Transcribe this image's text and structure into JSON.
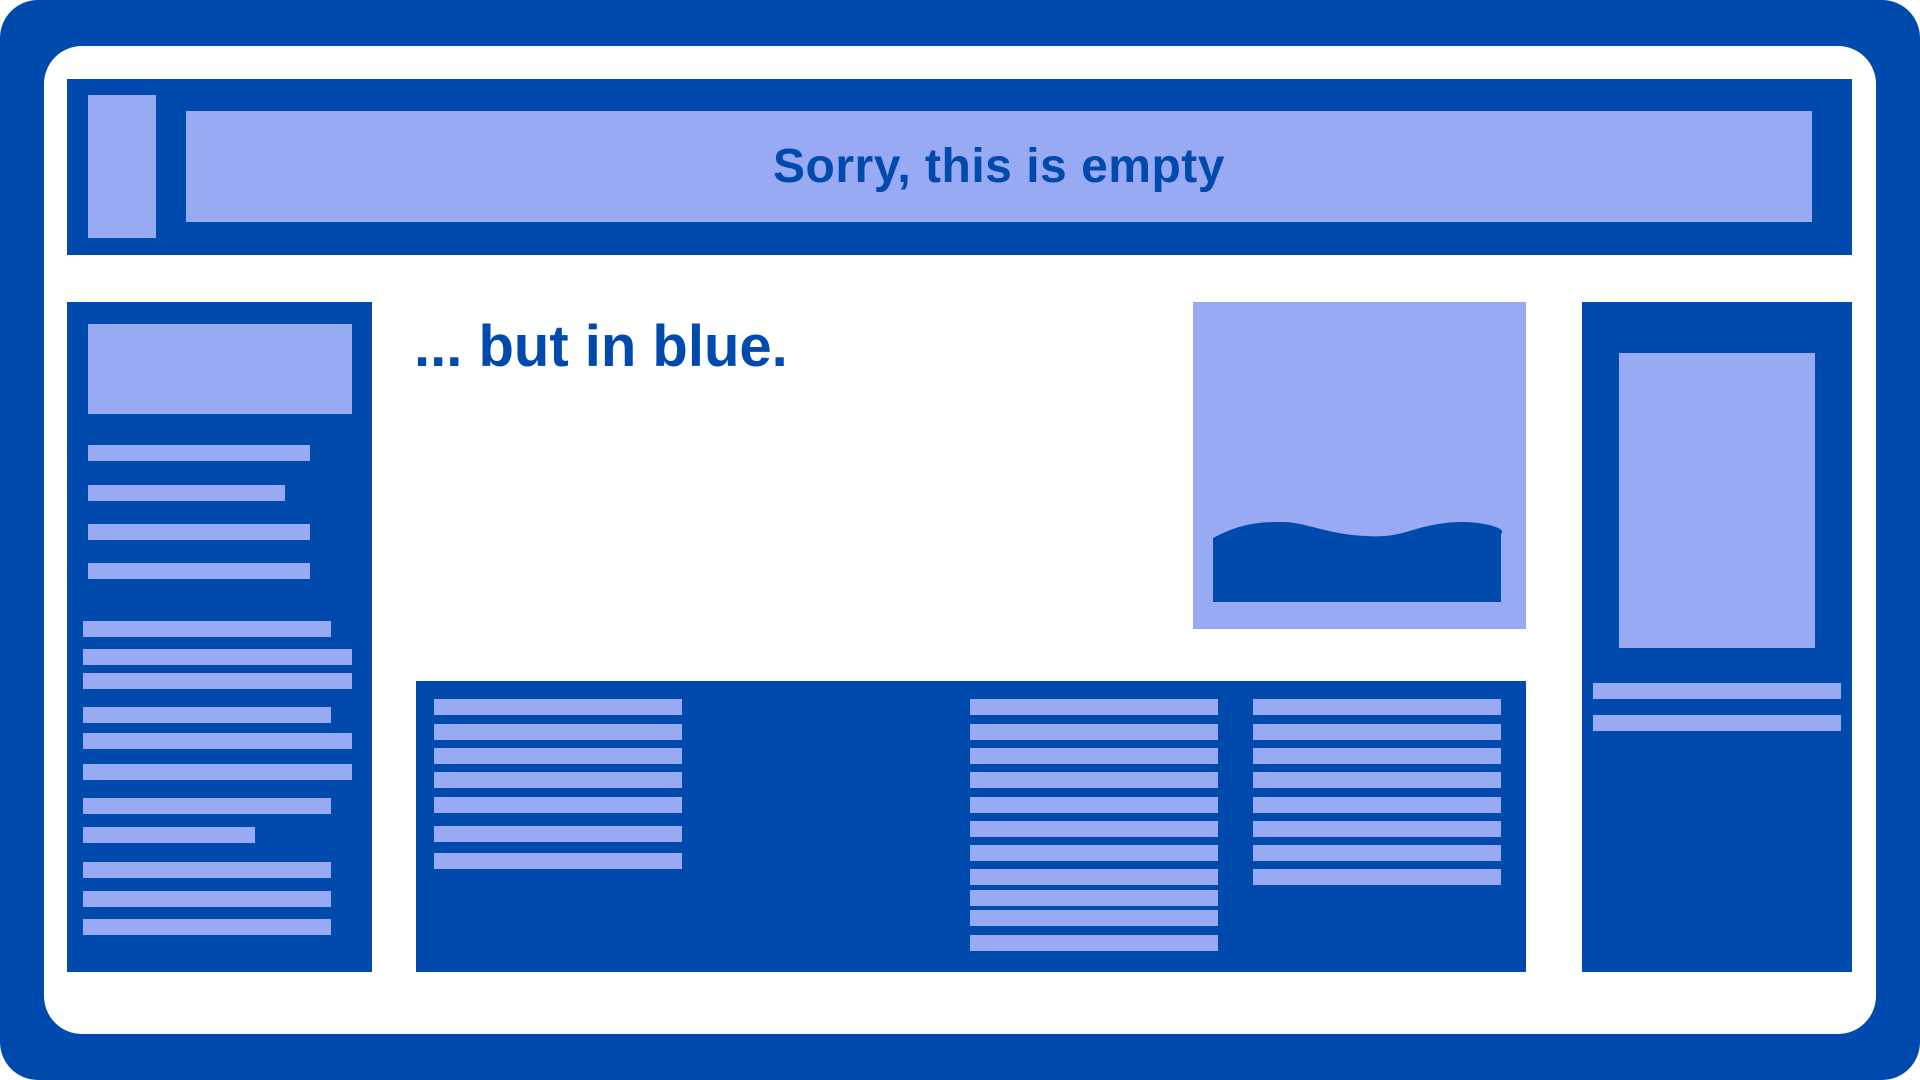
{
  "header": {
    "title": "Sorry, this is empty"
  },
  "main": {
    "tagline": "... but in blue."
  },
  "colors": {
    "dark_blue": "#004aad",
    "light_blue": "#99aaf5",
    "background": "#ffffff"
  },
  "icons": {
    "image_placeholder": "landscape-image-icon"
  }
}
